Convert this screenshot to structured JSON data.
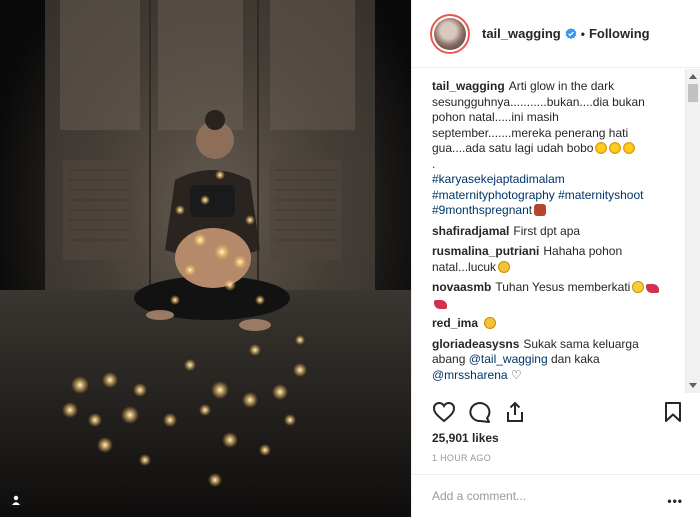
{
  "post": {
    "username": "tail_wagging",
    "verified_icon": "verified-badge-icon",
    "follow_separator": "•",
    "follow_status": "Following"
  },
  "comments": [
    {
      "user": "tail_wagging",
      "text": "Arti glow in the dark sesungguhnya...........bukan....dia bukan pohon natal.....ini masih september.......mereka penerang hati gua....ada satu lagi udah bobo",
      "trail": ".",
      "hashtags": "#karyasekejaptadimalam #maternityphotography #maternityshoot #9monthspregnant"
    },
    {
      "user": "shafiradjamal",
      "text": "First dpt apa"
    },
    {
      "user": "rusmalina_putriani",
      "text": "Hahaha pohon natal...lucuk"
    },
    {
      "user": "novaasmb",
      "text": "Tuhan Yesus memberkati"
    },
    {
      "user": "red_ima",
      "text": ""
    },
    {
      "user": "gloriadeasysns",
      "text": "Sukak sama keluarga abang",
      "mention1": "@tail_wagging",
      "mid": "dan kaka",
      "mention2": "@mrssharena",
      "suffix": "♡"
    }
  ],
  "likes": "25,901 likes",
  "time_ago": "1 HOUR AGO",
  "add_comment_placeholder": "Add a comment...",
  "more_label": "•••",
  "colors": {
    "link": "#003569",
    "avatar_ring": "#e95950",
    "muted": "#999999"
  }
}
